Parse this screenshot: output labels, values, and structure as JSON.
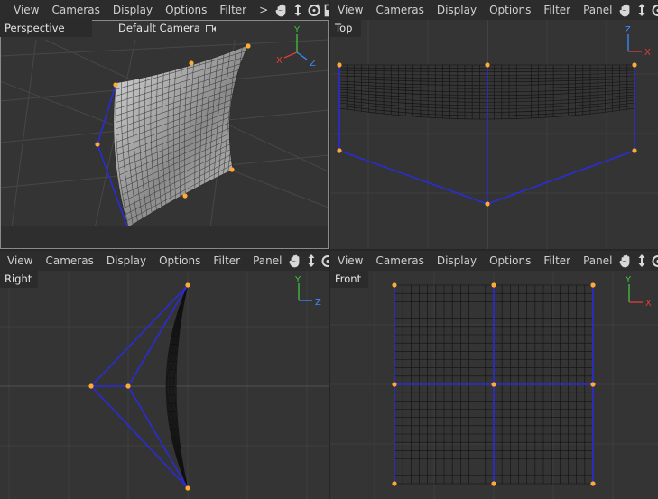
{
  "viewports": {
    "perspective": {
      "menu": [
        "View",
        "Cameras",
        "Display",
        "Options",
        "Filter",
        ">"
      ],
      "label": "Perspective",
      "camera": "Default Camera"
    },
    "top": {
      "menu": [
        "View",
        "Cameras",
        "Display",
        "Options",
        "Filter",
        "Panel"
      ],
      "label": "Top"
    },
    "right": {
      "menu": [
        "View",
        "Cameras",
        "Display",
        "Options",
        "Filter",
        "Panel"
      ],
      "label": "Right"
    },
    "front": {
      "menu": [
        "View",
        "Cameras",
        "Display",
        "Options",
        "Filter",
        "Panel"
      ],
      "label": "Front"
    }
  },
  "axes": {
    "perspective": [
      "Y",
      "X",
      "Z"
    ],
    "top": [
      "Z",
      "X"
    ],
    "right": [
      "Y",
      "Z"
    ],
    "front": [
      "Y",
      "X"
    ]
  },
  "nav_icons": [
    "pan-hand-icon",
    "move-arrows-icon",
    "rotate-icon",
    "maximize-icon"
  ],
  "colors": {
    "background": "#343434",
    "grid": "#3e3e3e",
    "axis_line": "#505050",
    "cage": "#2b2bd8",
    "point": "#ffaa33",
    "axis_x": "#e23c3c",
    "axis_y": "#3ec43e",
    "axis_z": "#3a8cff"
  }
}
